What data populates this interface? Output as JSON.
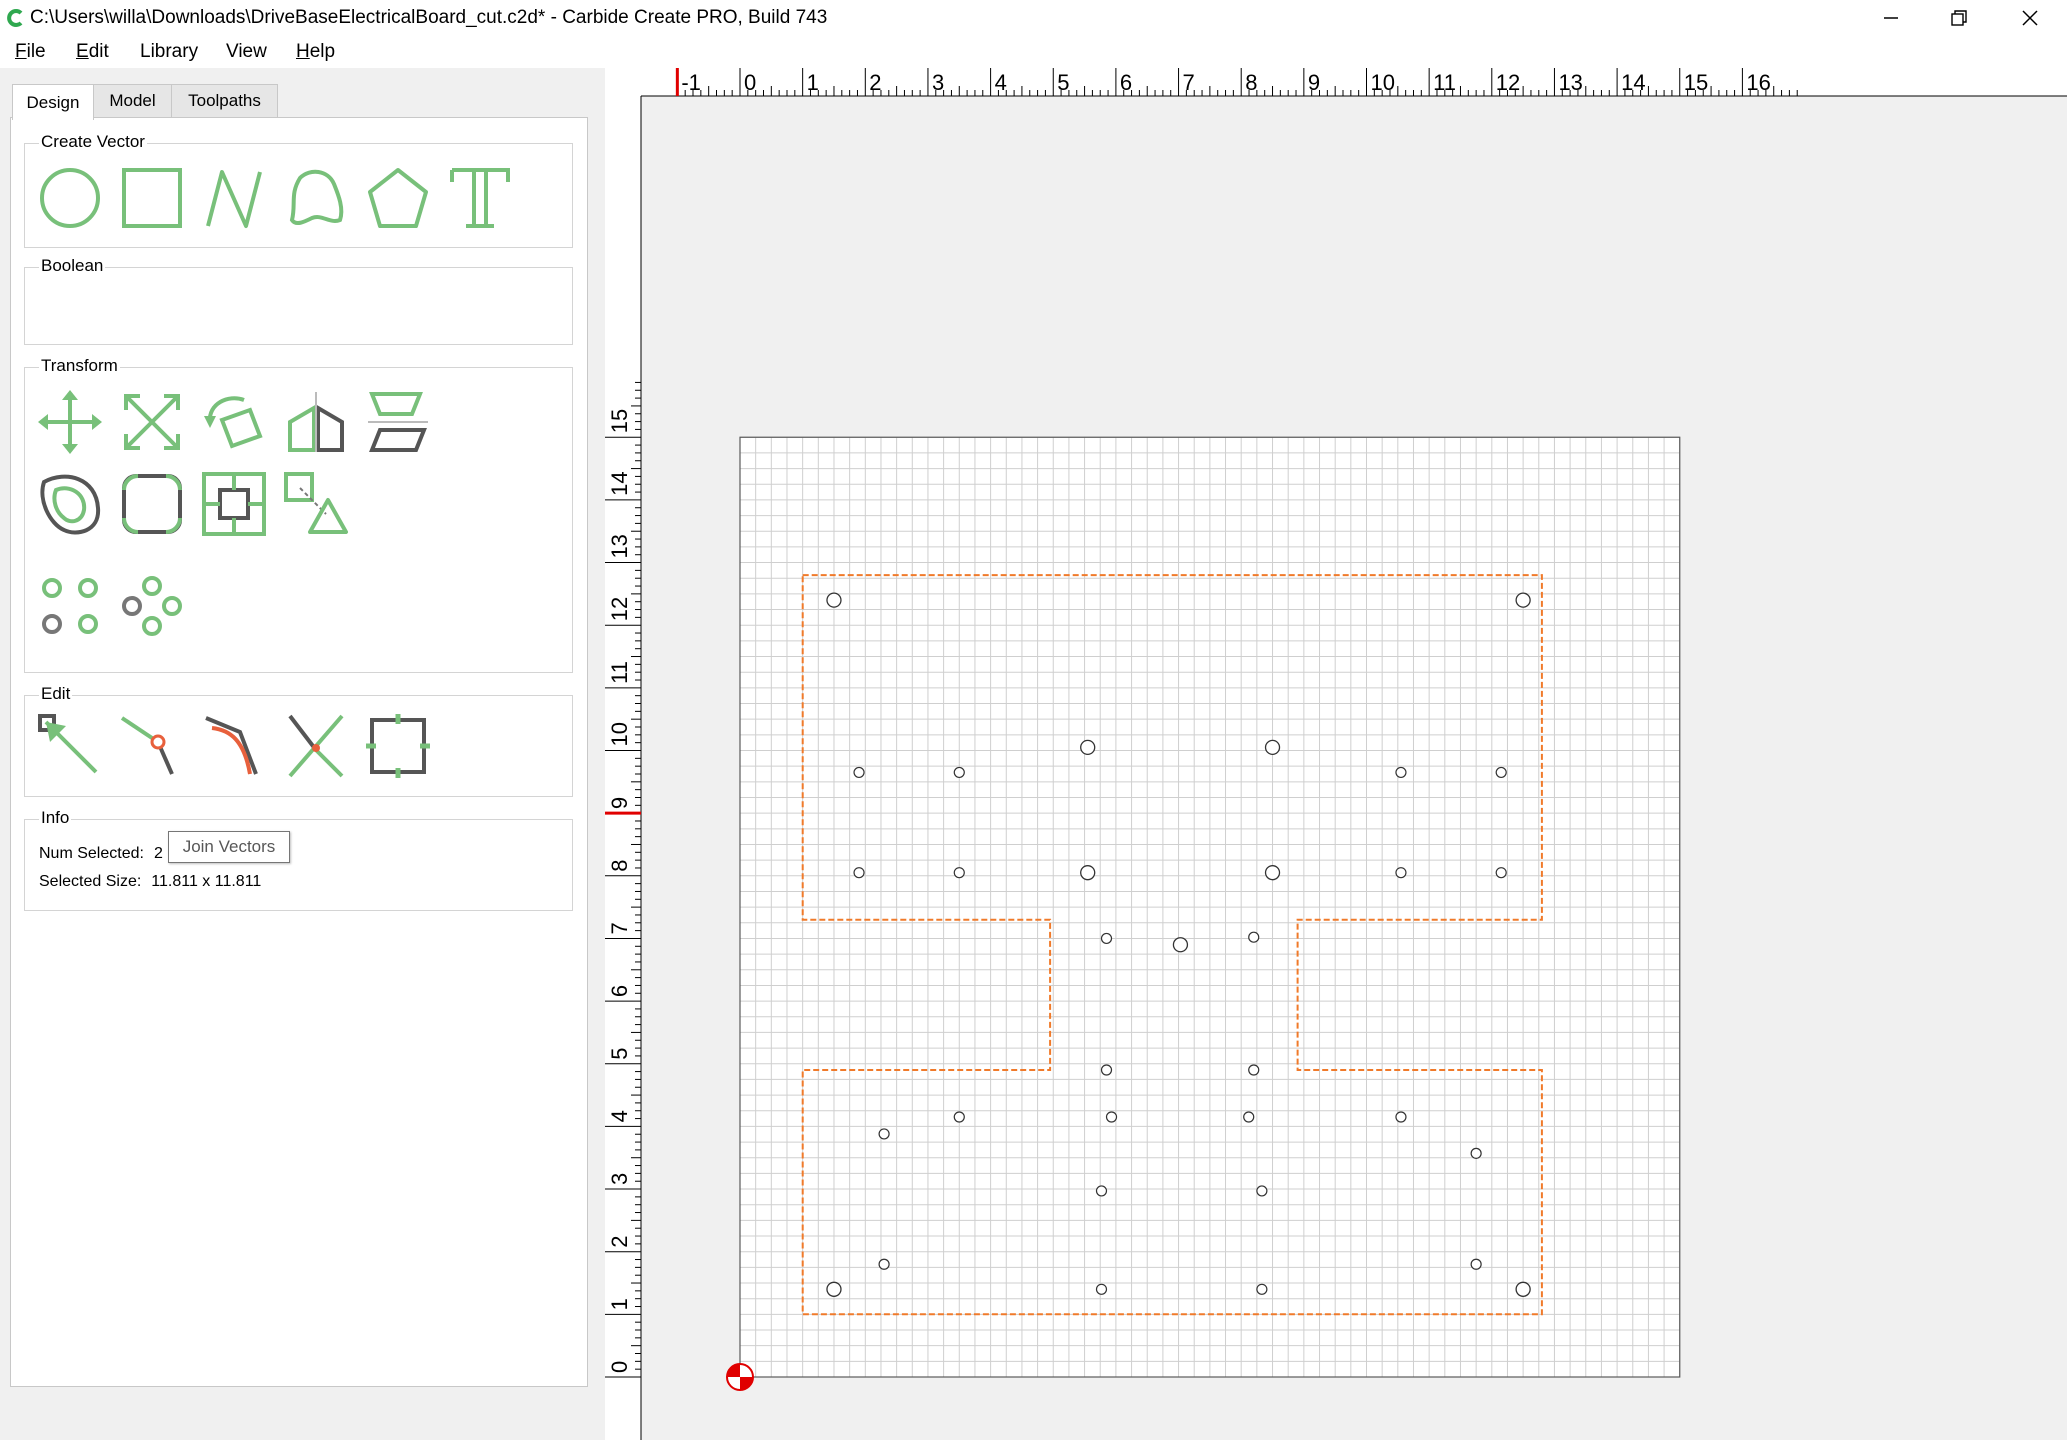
{
  "window": {
    "title": "C:\\Users\\willa\\Downloads\\DriveBaseElectricalBoard_cut.c2d* - Carbide Create PRO, Build 743",
    "app_icon": "carbide-create-icon",
    "controls": [
      "minimize-icon",
      "restore-icon",
      "close-icon"
    ]
  },
  "menu": [
    {
      "label": "File",
      "accel": "F",
      "rest": "ile"
    },
    {
      "label": "Edit",
      "accel": "E",
      "rest": "dit"
    },
    {
      "label": "Library",
      "accel": "",
      "rest": "Library"
    },
    {
      "label": "View",
      "accel": "",
      "rest": "View"
    },
    {
      "label": "Help",
      "accel": "H",
      "rest": "elp"
    }
  ],
  "tabs": [
    {
      "label": "Design",
      "active": true
    },
    {
      "label": "Model",
      "active": false
    },
    {
      "label": "Toolpaths",
      "active": false
    }
  ],
  "groups": {
    "create_vector": {
      "title": "Create Vector",
      "tools": [
        "circle-tool-icon",
        "rectangle-tool-icon",
        "polyline-tool-icon",
        "curve-tool-icon",
        "polygon-tool-icon",
        "text-tool-icon"
      ]
    },
    "boolean": {
      "title": "Boolean",
      "tools": []
    },
    "transform": {
      "title": "Transform",
      "tools": [
        "move-icon",
        "scale-icon",
        "rotate-icon",
        "mirror-icon",
        "align-icon",
        "offset-icon",
        "fillet-icon",
        "center-icon",
        "transform-icon",
        "linear-array-icon",
        "circular-array-icon"
      ]
    },
    "edit": {
      "title": "Edit",
      "tools": [
        "node-edit-icon",
        "join-vectors-icon",
        "smooth-join-icon",
        "trim-icon",
        "bounding-box-icon"
      ]
    },
    "info": {
      "title": "Info",
      "num_selected_label": "Num Selected:",
      "num_selected_value": "2",
      "selected_size_label": "Selected Size:",
      "selected_size_value": "11.811 x 11.811"
    }
  },
  "tooltip": "Join Vectors",
  "canvas": {
    "x_ruler_labels": [
      "-1",
      "0",
      "1",
      "2",
      "3",
      "4",
      "5",
      "6",
      "7",
      "8",
      "9",
      "10",
      "11",
      "12",
      "13",
      "14",
      "15",
      "16"
    ],
    "y_ruler_labels": [
      "0",
      "1",
      "2",
      "3",
      "4",
      "5",
      "6",
      "7",
      "8",
      "9",
      "10",
      "11",
      "12",
      "13",
      "14",
      "15"
    ],
    "stock": {
      "x_min": 0,
      "x_max": 15,
      "y_min": 0,
      "y_max": 15
    },
    "grid_minor": 0.25,
    "origin_marker": "origin-icon",
    "cursor_ruler": {
      "x": -1,
      "y": 9
    },
    "outline_color": "#f07a2a",
    "outline_points": [
      [
        1,
        12.8
      ],
      [
        12.8,
        12.8
      ],
      [
        12.8,
        7.3
      ],
      [
        8.9,
        7.3
      ],
      [
        8.9,
        4.9
      ],
      [
        12.8,
        4.9
      ],
      [
        12.8,
        1
      ],
      [
        1,
        1
      ],
      [
        1,
        4.9
      ],
      [
        4.95,
        4.9
      ],
      [
        4.95,
        7.3
      ],
      [
        1,
        7.3
      ]
    ],
    "holes_large": [
      [
        1.5,
        12.4
      ],
      [
        12.5,
        12.4
      ],
      [
        5.55,
        10.05
      ],
      [
        8.5,
        10.05
      ],
      [
        5.55,
        8.05
      ],
      [
        8.5,
        8.05
      ],
      [
        1.5,
        1.4
      ],
      [
        12.5,
        1.4
      ],
      [
        7.03,
        6.9
      ]
    ],
    "holes_small": [
      [
        1.9,
        9.65
      ],
      [
        3.5,
        9.65
      ],
      [
        10.55,
        9.65
      ],
      [
        12.15,
        9.65
      ],
      [
        1.9,
        8.05
      ],
      [
        3.5,
        8.05
      ],
      [
        10.55,
        8.05
      ],
      [
        12.15,
        8.05
      ],
      [
        5.85,
        7.0
      ],
      [
        8.2,
        7.02
      ],
      [
        5.85,
        4.9
      ],
      [
        8.2,
        4.9
      ],
      [
        3.5,
        4.15
      ],
      [
        5.93,
        4.15
      ],
      [
        8.12,
        4.15
      ],
      [
        10.55,
        4.15
      ],
      [
        2.3,
        3.88
      ],
      [
        11.75,
        3.57
      ],
      [
        5.77,
        2.97
      ],
      [
        8.33,
        2.97
      ],
      [
        2.3,
        1.8
      ],
      [
        11.75,
        1.8
      ],
      [
        5.77,
        1.4
      ],
      [
        8.33,
        1.4
      ]
    ]
  }
}
